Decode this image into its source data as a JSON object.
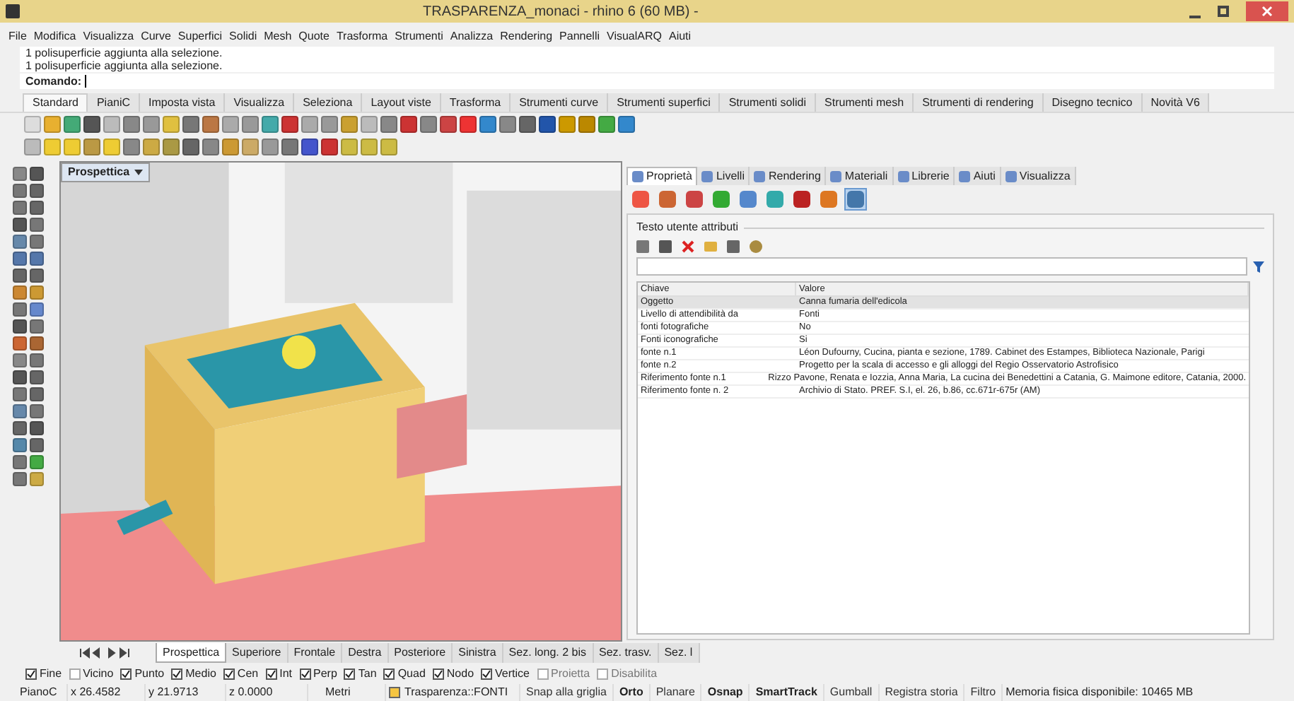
{
  "window": {
    "title": "TRASPARENZA_monaci - rhino 6 (60 MB) -"
  },
  "menu": [
    "File",
    "Modifica",
    "Visualizza",
    "Curve",
    "Superfici",
    "Solidi",
    "Mesh",
    "Quote",
    "Trasforma",
    "Strumenti",
    "Analizza",
    "Rendering",
    "Pannelli",
    "VisualARQ",
    "Aiuti"
  ],
  "history": [
    "1 polisuperficie aggiunta alla selezione.",
    "1 polisuperficie aggiunta alla selezione."
  ],
  "command": {
    "label": "Comando:"
  },
  "toolbar_tabs": [
    {
      "label": "Standard",
      "selected": true
    },
    {
      "label": "PianiC",
      "selected": false
    },
    {
      "label": "Imposta vista",
      "selected": false
    },
    {
      "label": "Visualizza",
      "selected": false
    },
    {
      "label": "Seleziona",
      "selected": false
    },
    {
      "label": "Layout viste",
      "selected": false
    },
    {
      "label": "Trasforma",
      "selected": false
    },
    {
      "label": "Strumenti curve",
      "selected": false
    },
    {
      "label": "Strumenti superfici",
      "selected": false
    },
    {
      "label": "Strumenti solidi",
      "selected": false
    },
    {
      "label": "Strumenti mesh",
      "selected": false
    },
    {
      "label": "Strumenti di rendering",
      "selected": false
    },
    {
      "label": "Disegno tecnico",
      "selected": false
    },
    {
      "label": "Novità V6",
      "selected": false
    }
  ],
  "viewport": {
    "label": "Prospettica"
  },
  "viewport_tabs": [
    {
      "label": "Prospettica",
      "selected": true
    },
    {
      "label": "Superiore",
      "selected": false
    },
    {
      "label": "Frontale",
      "selected": false
    },
    {
      "label": "Destra",
      "selected": false
    },
    {
      "label": "Posteriore",
      "selected": false
    },
    {
      "label": "Sinistra",
      "selected": false
    },
    {
      "label": "Sez. long. 2 bis",
      "selected": false
    },
    {
      "label": "Sez. trasv.",
      "selected": false
    },
    {
      "label": "Sez. l",
      "selected": false
    }
  ],
  "panel_tabs": [
    {
      "label": "Proprietà",
      "selected": true
    },
    {
      "label": "Livelli",
      "selected": false
    },
    {
      "label": "Rendering",
      "selected": false
    },
    {
      "label": "Materiali",
      "selected": false
    },
    {
      "label": "Librerie",
      "selected": false
    },
    {
      "label": "Aiuti",
      "selected": false
    },
    {
      "label": "Visualizza",
      "selected": false
    }
  ],
  "property_pages": [
    {
      "selected": false
    },
    {
      "selected": false
    },
    {
      "selected": false
    },
    {
      "selected": false
    },
    {
      "selected": false
    },
    {
      "selected": false
    },
    {
      "selected": false
    },
    {
      "selected": false
    },
    {
      "selected": true
    }
  ],
  "group_title": "Testo utente attributi",
  "table": {
    "columns": [
      "Chiave",
      "Valore"
    ],
    "rows": [
      {
        "key": "Oggetto",
        "value": "Canna fumaria dell'edicola",
        "selected": true
      },
      {
        "key": "Livello di attendibilità da",
        "value": "Fonti",
        "selected": false
      },
      {
        "key": "fonti fotografiche",
        "value": "No",
        "selected": false
      },
      {
        "key": "Fonti iconografiche",
        "value": "Si",
        "selected": false
      },
      {
        "key": "fonte n.1",
        "value": "Léon Dufourny, Cucina, pianta e sezione, 1789. Cabinet des Estampes, Biblioteca Nazionale, Parigi",
        "selected": false
      },
      {
        "key": "fonte n.2",
        "value": "Progetto per la scala di accesso e gli alloggi del Regio Osservatorio Astrofisico",
        "selected": false
      },
      {
        "key": "Riferimento fonte n.1",
        "value": "Rizzo Pavone, Renata e Iozzia, Anna Maria, La cucina dei Benedettini a Catania, G. Maimone editore, Catania, 2000.",
        "selected": false
      },
      {
        "key": "Riferimento fonte n. 2",
        "value": "Archivio di Stato. PREF. S.I, el. 26, b.86, cc.671r-675r (AM)",
        "selected": false
      }
    ]
  },
  "osnaps": [
    {
      "label": "Fine",
      "checked": true
    },
    {
      "label": "Vicino",
      "checked": false
    },
    {
      "label": "Punto",
      "checked": true
    },
    {
      "label": "Medio",
      "checked": true
    },
    {
      "label": "Cen",
      "checked": true
    },
    {
      "label": "Int",
      "checked": true
    },
    {
      "label": "Perp",
      "checked": true
    },
    {
      "label": "Tan",
      "checked": true
    },
    {
      "label": "Quad",
      "checked": true
    },
    {
      "label": "Nodo",
      "checked": true
    },
    {
      "label": "Vertice",
      "checked": true
    },
    {
      "label": "Proietta",
      "checked": false
    },
    {
      "label": "Disabilita",
      "checked": false
    }
  ],
  "status_bar": {
    "plane": "PianoC",
    "x": "x 26.4582",
    "y": "y 21.9713",
    "z": "z 0.0000",
    "units": "Metri",
    "layer": {
      "name": "Trasparenza::FONTI",
      "color": "#f5c542"
    },
    "toggles": [
      {
        "label": "Snap alla griglia",
        "on": false
      },
      {
        "label": "Orto",
        "on": true
      },
      {
        "label": "Planare",
        "on": false
      },
      {
        "label": "Osnap",
        "on": true
      },
      {
        "label": "SmartTrack",
        "on": true
      },
      {
        "label": "Gumball",
        "on": false
      },
      {
        "label": "Registra storia",
        "on": false
      },
      {
        "label": "Filtro",
        "on": false
      }
    ],
    "memory": "Memoria fisica disponibile: 10465 MB"
  }
}
